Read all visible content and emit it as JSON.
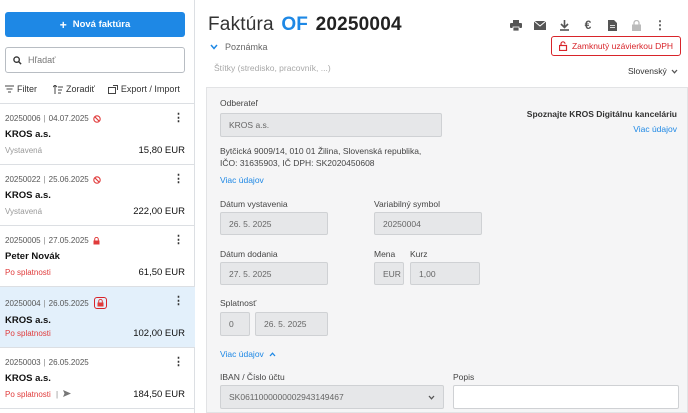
{
  "sidebar": {
    "new_invoice_label": "Nová faktúra",
    "search_placeholder": "Hľadať",
    "filter_label": "Filter",
    "sort_label": "Zoradiť",
    "export_label": "Export / Import",
    "items": [
      {
        "number": "20250006",
        "date": "04.07.2025",
        "status_icon": "cancel-circle-icon",
        "customer": "KROS a.s.",
        "state": "Vystavená",
        "amount": "15,80 EUR"
      },
      {
        "number": "20250022",
        "date": "25.06.2025",
        "status_icon": "cancel-circle-icon",
        "customer": "KROS a.s.",
        "state": "Vystavená",
        "amount": "222,00 EUR"
      },
      {
        "number": "20250005",
        "date": "27.05.2025",
        "status_icon": "lock-icon",
        "customer": "Peter Novák",
        "state": "Po splatnosti",
        "amount": "61,50 EUR"
      },
      {
        "number": "20250004",
        "date": "26.05.2025",
        "status_icon": "lock-icon",
        "customer": "KROS a.s.",
        "state": "Po splatnosti",
        "amount": "102,00 EUR",
        "active": true
      },
      {
        "number": "20250003",
        "date": "26.05.2025",
        "status_icon": "send-icon",
        "customer": "KROS a.s.",
        "state": "Po splatnosti",
        "amount": "184,50 EUR"
      }
    ]
  },
  "header": {
    "title_prefix": "Faktúra",
    "title_type": "OF",
    "title_number": "20250004",
    "note_label": "Poznámka",
    "tags_placeholder": "Štítky (stredisko, pracovník, ...)",
    "locked_badge": "Zamknutý uzávierkou DPH",
    "language": "Slovenský"
  },
  "form": {
    "customer_label": "Odberateľ",
    "customer_value": "KROS a.s.",
    "address_line1": "Bytčická 9009/14, 010 01 Žilina, Slovenská republika,",
    "address_line2": "IČO: 31635903, IČ DPH: SK2020450608",
    "more_details_1": "Viac údajov",
    "promo_text": "Spoznajte KROS Digitálnu kanceláriu",
    "promo_link": "Viac údajov",
    "issue_date_label": "Dátum vystavenia",
    "issue_date_value": "26. 5. 2025",
    "var_symbol_label": "Variabilný symbol",
    "var_symbol_value": "20250004",
    "delivery_date_label": "Dátum dodania",
    "delivery_date_value": "27. 5. 2025",
    "currency_label": "Mena",
    "currency_value": "EUR",
    "rate_label": "Kurz",
    "rate_value": "1,00",
    "due_label": "Splatnosť",
    "due_days_value": "0",
    "due_date_value": "26. 5. 2025",
    "more_details_2": "Viac údajov",
    "iban_label": "IBAN / Číslo účtu",
    "iban_value": "SK0611000000002943149467",
    "description_label": "Popis"
  },
  "colors": {
    "accent": "#1e88e5",
    "danger": "#d8242a",
    "active_row": "#e3f0fb"
  }
}
